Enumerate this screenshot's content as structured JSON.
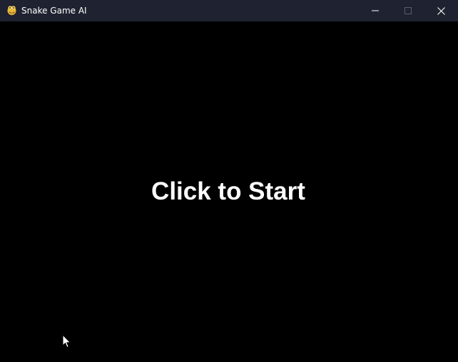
{
  "window": {
    "title": "Snake Game AI",
    "app_icon": "python-snake-icon",
    "controls": {
      "minimize_icon": "minimize-icon",
      "maximize_icon": "maximize-icon",
      "close_icon": "close-icon"
    }
  },
  "game": {
    "start_prompt": "Click to Start"
  },
  "colors": {
    "titlebar_bg": "#1f2331",
    "canvas_bg": "#000000",
    "text": "#ffffff",
    "icon_yellow": "#f2c641"
  }
}
